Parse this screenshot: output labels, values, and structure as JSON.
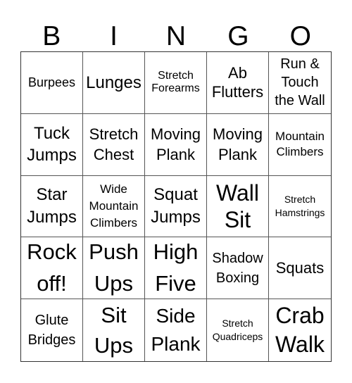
{
  "header": {
    "letters": [
      "B",
      "I",
      "N",
      "G",
      "O"
    ]
  },
  "grid": {
    "cells": [
      "Burpees",
      "Lunges",
      "Stretch Forearms",
      "Ab Flutters",
      "Run & Touch the Wall",
      "Tuck Jumps",
      "Stretch Chest",
      "Moving Plank",
      "Moving Plank",
      "Mountain Climbers",
      "Star Jumps",
      "Wide Mountain Climbers",
      "Squat Jumps",
      "Wall Sit",
      "Stretch Hamstrings",
      "Rock off!",
      "Push Ups",
      "High Five",
      "Shadow Boxing",
      "Squats",
      "Glute Bridges",
      "Sit Ups",
      "Side Plank",
      "Stretch Quadriceps",
      "Crab Walk"
    ]
  }
}
